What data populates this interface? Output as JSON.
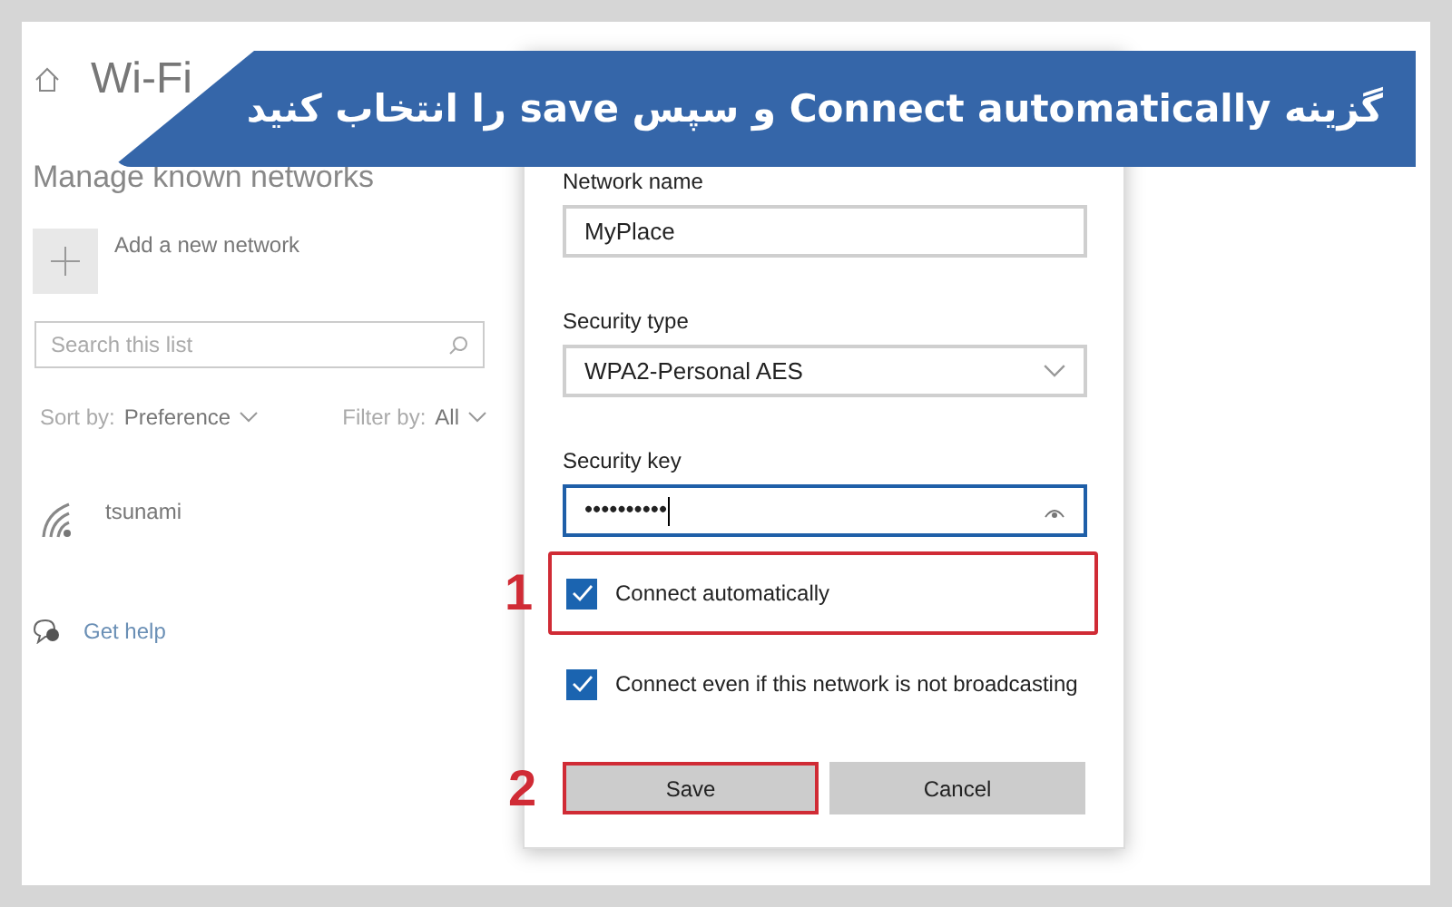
{
  "banner": {
    "text": "گزینه Connect automatically و سپس save را انتخاب کنید"
  },
  "settings": {
    "title": "Wi-Fi",
    "heading": "Manage known networks",
    "add_network": "Add a new network",
    "search": {
      "placeholder": "Search this list"
    },
    "sort": {
      "label": "Sort by:",
      "value": "Preference"
    },
    "filter": {
      "label": "Filter by:",
      "value": "All"
    },
    "networks": [
      {
        "name": "tsunami"
      }
    ],
    "help_link": "Get help"
  },
  "dialog": {
    "fields": [
      {
        "kind": "text",
        "label": "Network name",
        "value": "MyPlace",
        "focused": false
      },
      {
        "kind": "select",
        "label": "Security type",
        "value": "WPA2-Personal AES",
        "focused": false
      },
      {
        "kind": "password",
        "label": "Security key",
        "value": "••••••••••",
        "focused": true
      }
    ],
    "checkboxes": [
      {
        "label": "Connect automatically",
        "checked": true,
        "highlighted": true,
        "step": "1"
      },
      {
        "label": "Connect even if this network is not broadcasting",
        "checked": true,
        "highlighted": false
      }
    ],
    "buttons": [
      {
        "label": "Save",
        "highlighted": true,
        "step": "2"
      },
      {
        "label": "Cancel",
        "highlighted": false
      }
    ]
  }
}
